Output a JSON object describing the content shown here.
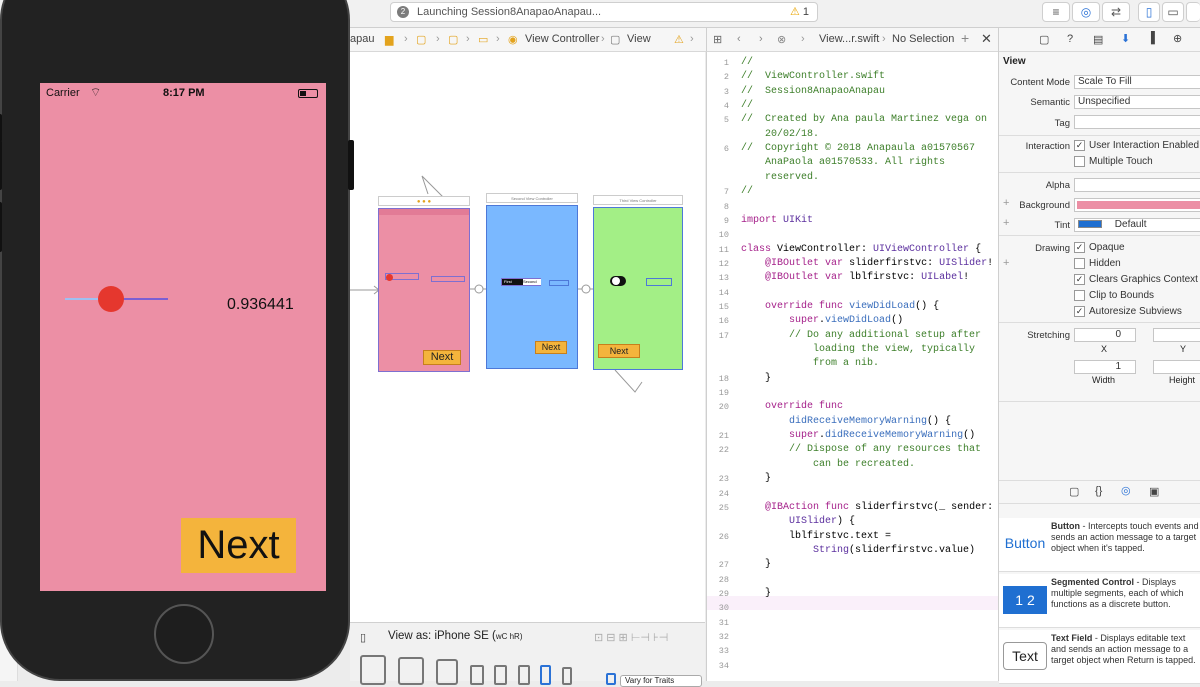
{
  "toolbar": {
    "activity_number": "2",
    "activity_text": "Launching Session8AnapaoAnapau...",
    "warning_count": "1",
    "left_fragment": "s"
  },
  "jumpbar": {
    "project_fragment": "apau",
    "view_controller": "View Controller",
    "view": "View"
  },
  "editor_bar": {
    "file": "View...r.swift",
    "selection": "No Selection"
  },
  "phone": {
    "carrier": "Carrier",
    "time": "8:17 PM",
    "slider_value": 0.45,
    "value_label": "0.936441",
    "next_button": "Next"
  },
  "storyboard": {
    "scene2_title": "Second View Controller",
    "scene3_title": "Third View Controller",
    "next_label": "Next",
    "seg_first": "First",
    "seg_second": "Second"
  },
  "canvas_bar": {
    "view_as": "View as: iPhone SE (",
    "size_class": "wC hR)",
    "vary_label": "Vary for Traits"
  },
  "code": [
    {
      "n": "1",
      "t": "//"
    },
    {
      "n": "2",
      "t": "//  ViewController.swift"
    },
    {
      "n": "3",
      "t": "//  Session8AnapaoAnapau"
    },
    {
      "n": "4",
      "t": "//"
    },
    {
      "n": "5",
      "t": "//  Created by Ana paula Martinez vega on"
    },
    {
      "n": "",
      "t": "    20/02/18."
    },
    {
      "n": "6",
      "t": "//  Copyright © 2018 Anapaula a01570567"
    },
    {
      "n": "",
      "t": "    AnaPaola a01570533. All rights"
    },
    {
      "n": "",
      "t": "    reserved."
    },
    {
      "n": "7",
      "t": "//"
    },
    {
      "n": "8",
      "t": ""
    },
    {
      "n": "9",
      "t": "import UIKit"
    },
    {
      "n": "10",
      "t": ""
    },
    {
      "n": "11",
      "t": "class ViewController: UIViewController {"
    },
    {
      "n": "12",
      "t": "    @IBOutlet var sliderfirstvc: UISlider!"
    },
    {
      "n": "13",
      "t": "    @IBOutlet var lblfirstvc: UILabel!"
    },
    {
      "n": "14",
      "t": ""
    },
    {
      "n": "15",
      "t": "    override func viewDidLoad() {"
    },
    {
      "n": "16",
      "t": "        super.viewDidLoad()"
    },
    {
      "n": "17",
      "t": "        // Do any additional setup after"
    },
    {
      "n": "",
      "t": "            loading the view, typically"
    },
    {
      "n": "",
      "t": "            from a nib."
    },
    {
      "n": "18",
      "t": "    }"
    },
    {
      "n": "19",
      "t": ""
    },
    {
      "n": "20",
      "t": "    override func"
    },
    {
      "n": "",
      "t": "        didReceiveMemoryWarning() {"
    },
    {
      "n": "21",
      "t": "        super.didReceiveMemoryWarning()"
    },
    {
      "n": "22",
      "t": "        // Dispose of any resources that"
    },
    {
      "n": "",
      "t": "            can be recreated."
    },
    {
      "n": "23",
      "t": "    }"
    },
    {
      "n": "24",
      "t": ""
    },
    {
      "n": "25",
      "t": "    @IBAction func sliderfirstvc(_ sender:"
    },
    {
      "n": "",
      "t": "        UISlider) {"
    },
    {
      "n": "26",
      "t": "        lblfirstvc.text ="
    },
    {
      "n": "",
      "t": "            String(sliderfirstvc.value)"
    },
    {
      "n": "27",
      "t": "    }"
    },
    {
      "n": "28",
      "t": ""
    },
    {
      "n": "29",
      "t": "    }"
    },
    {
      "n": "30",
      "t": ""
    },
    {
      "n": "31",
      "t": ""
    },
    {
      "n": "32",
      "t": ""
    },
    {
      "n": "33",
      "t": ""
    },
    {
      "n": "34",
      "t": ""
    }
  ],
  "inspector": {
    "section": "View",
    "content_mode_label": "Content Mode",
    "content_mode": "Scale To Fill",
    "semantic_label": "Semantic",
    "semantic": "Unspecified",
    "tag_label": "Tag",
    "interaction_label": "Interaction",
    "user_interaction": "User Interaction Enabled",
    "multiple_touch": "Multiple Touch",
    "alpha_label": "Alpha",
    "background_label": "Background",
    "tint_label": "Tint",
    "tint_value": "Default",
    "drawing_label": "Drawing",
    "opaque": "Opaque",
    "hidden": "Hidden",
    "clears": "Clears Graphics Context",
    "clip": "Clip to Bounds",
    "autoresize": "Autoresize Subviews",
    "stretching_label": "Stretching",
    "stretch_x": "0",
    "stretch_w": "1",
    "x_label": "X",
    "y_label": "Y",
    "width_label": "Width",
    "height_label": "Height",
    "background_color": "#ec8fa5",
    "tint_color": "#1f6fd1"
  },
  "library": [
    {
      "icon": "Button",
      "title": "Button",
      "desc": " - Intercepts touch events and sends an action message to a target object when it's tapped."
    },
    {
      "icon": "1 2",
      "title": "Segmented Control",
      "desc": " - Displays multiple segments, each of which functions as a discrete button."
    },
    {
      "icon": "Text",
      "title": "Text Field",
      "desc": " - Displays editable text and sends an action message to a target object when Return is tapped."
    }
  ]
}
